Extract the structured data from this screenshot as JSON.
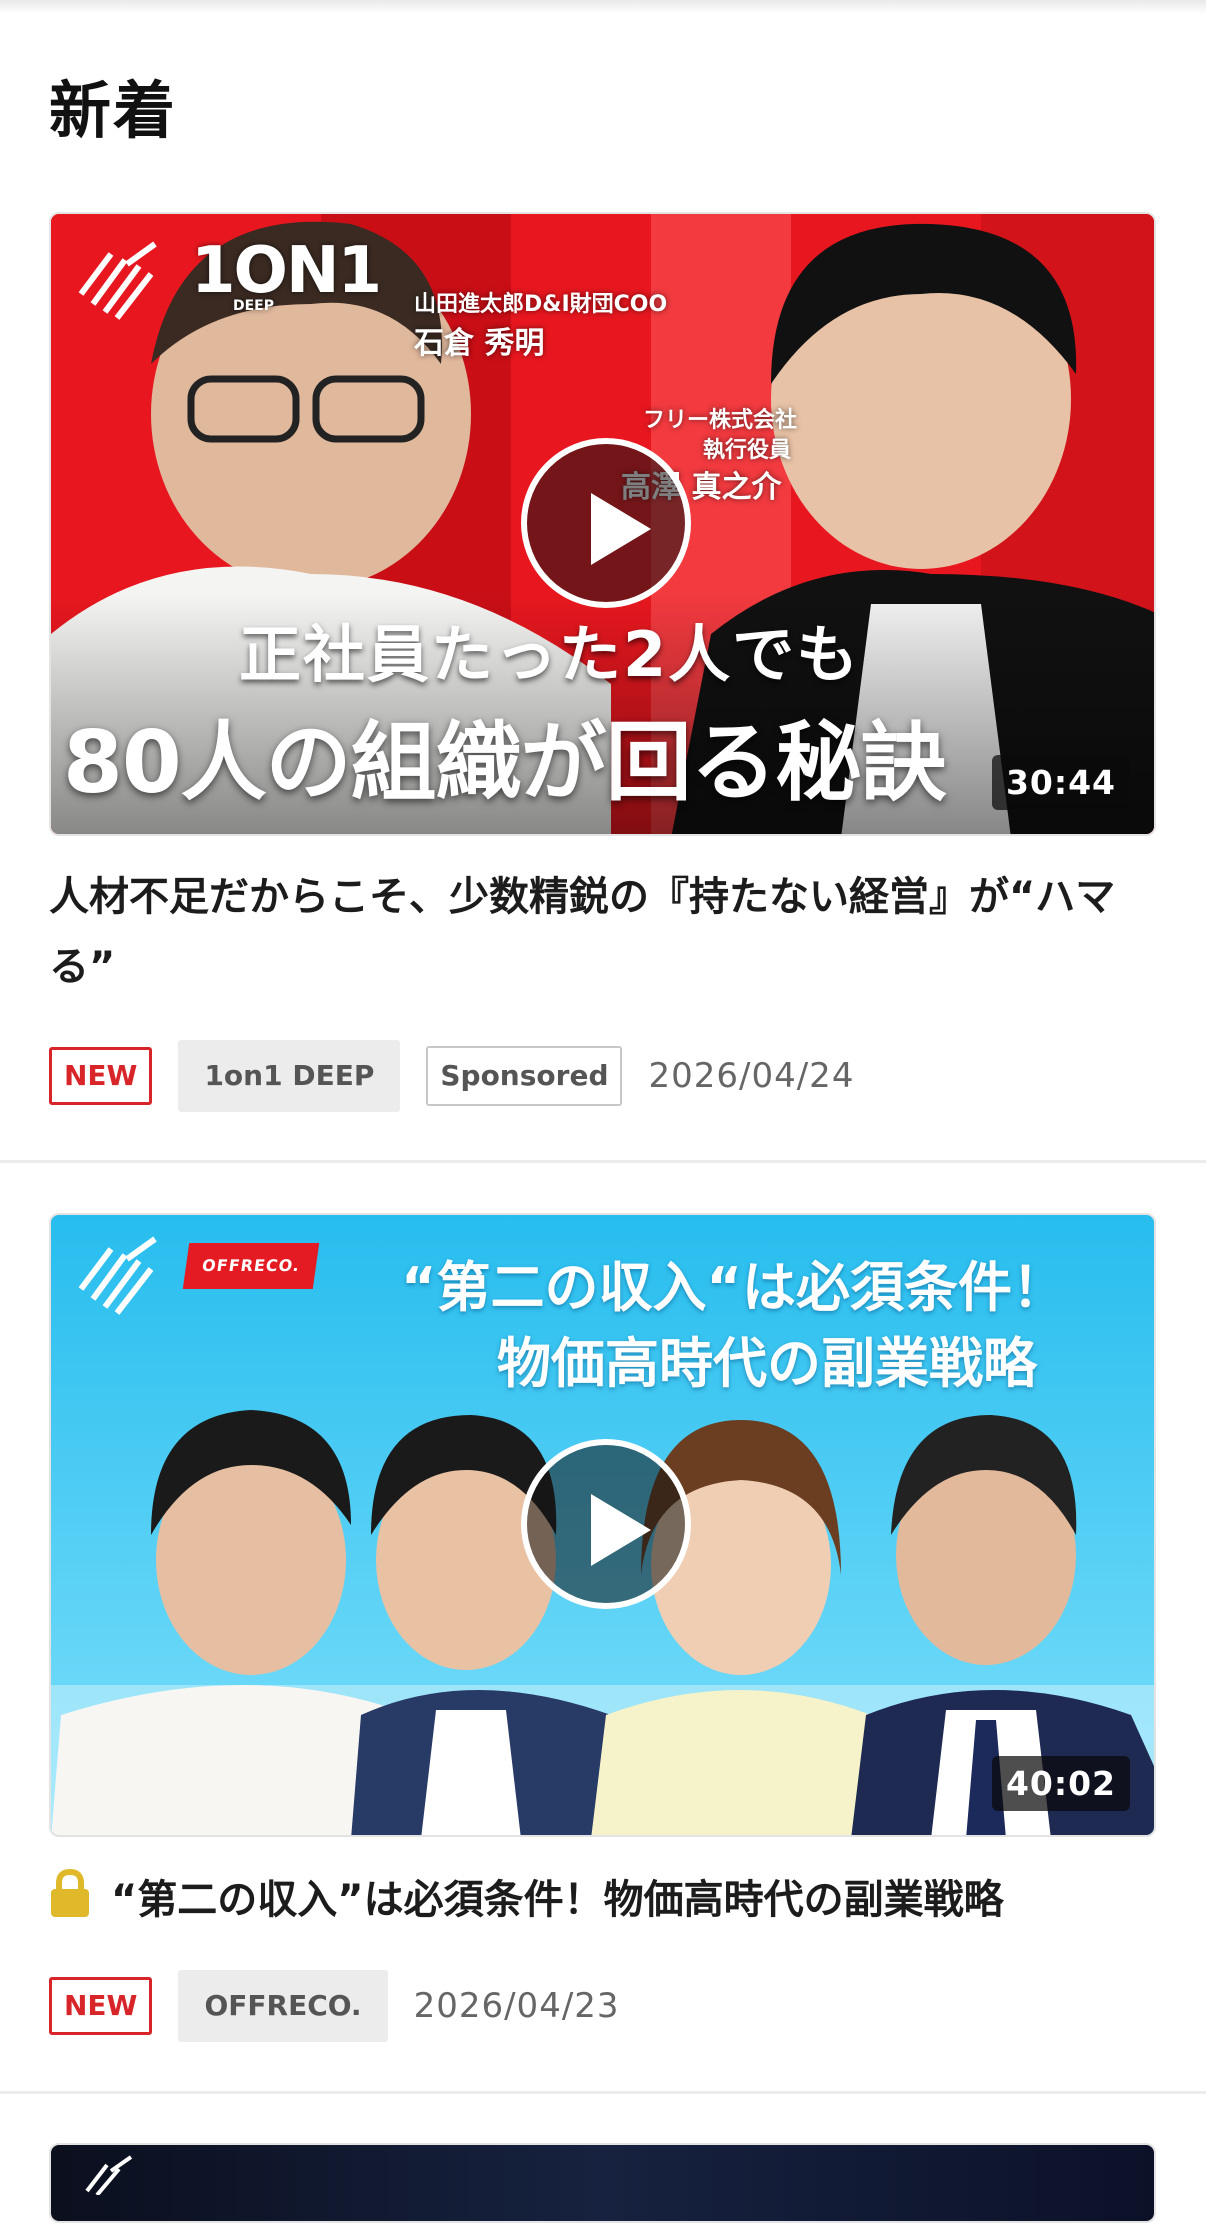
{
  "section": {
    "title": "新着"
  },
  "items": [
    {
      "title": "人材不足だからこそ、少数精鋭の『持たない経営』が“ハマる”",
      "duration": "30:44",
      "badge_new": "NEW",
      "channel": "1on1 DEEP",
      "sponsored": "Sponsored",
      "date": "2026/04/24",
      "locked": false,
      "thumbnail": {
        "brand": "1ON1",
        "brand_sub": "DEEP",
        "guest1_role": "山田進太郎D&I財団COO",
        "guest1_name": "石倉 秀明",
        "guest2_role_line1": "フリー株式会社",
        "guest2_role_line2": "執行役員",
        "guest2_name": "高澤 真之介",
        "headline1": "正社員たった2人でも",
        "headline2": "80人の組織が回る秘訣",
        "bg_color": "#e8171f"
      }
    },
    {
      "title": "“第二の収入”は必須条件！物価高時代の副業戦略",
      "duration": "40:02",
      "badge_new": "NEW",
      "channel": "OFFRECO.",
      "date": "2026/04/23",
      "locked": true,
      "thumbnail": {
        "brand": "OFFRECO.",
        "headline1": "“第二の収入“は必須条件！",
        "headline2": "物価高時代の副業戦略",
        "bg_color": "#2ec3f0"
      }
    }
  ],
  "colors": {
    "accent_red": "#d7252a",
    "lock_yellow": "#e0b92a"
  }
}
